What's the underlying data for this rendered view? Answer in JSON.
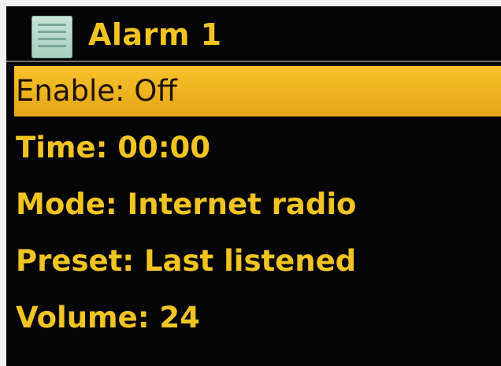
{
  "header": {
    "icon": "list-icon",
    "title": "Alarm 1"
  },
  "menu": {
    "items": [
      {
        "label": "Enable: Off",
        "selected": true
      },
      {
        "label": "Time: 00:00",
        "selected": false
      },
      {
        "label": "Mode: Internet radio",
        "selected": false
      },
      {
        "label": "Preset: Last listened",
        "selected": false
      },
      {
        "label": "Volume: 24",
        "selected": false
      }
    ]
  },
  "colors": {
    "text": "#f2c422",
    "highlight": "#eeb321",
    "background": "#050505",
    "highlight_text": "#1b1405"
  }
}
